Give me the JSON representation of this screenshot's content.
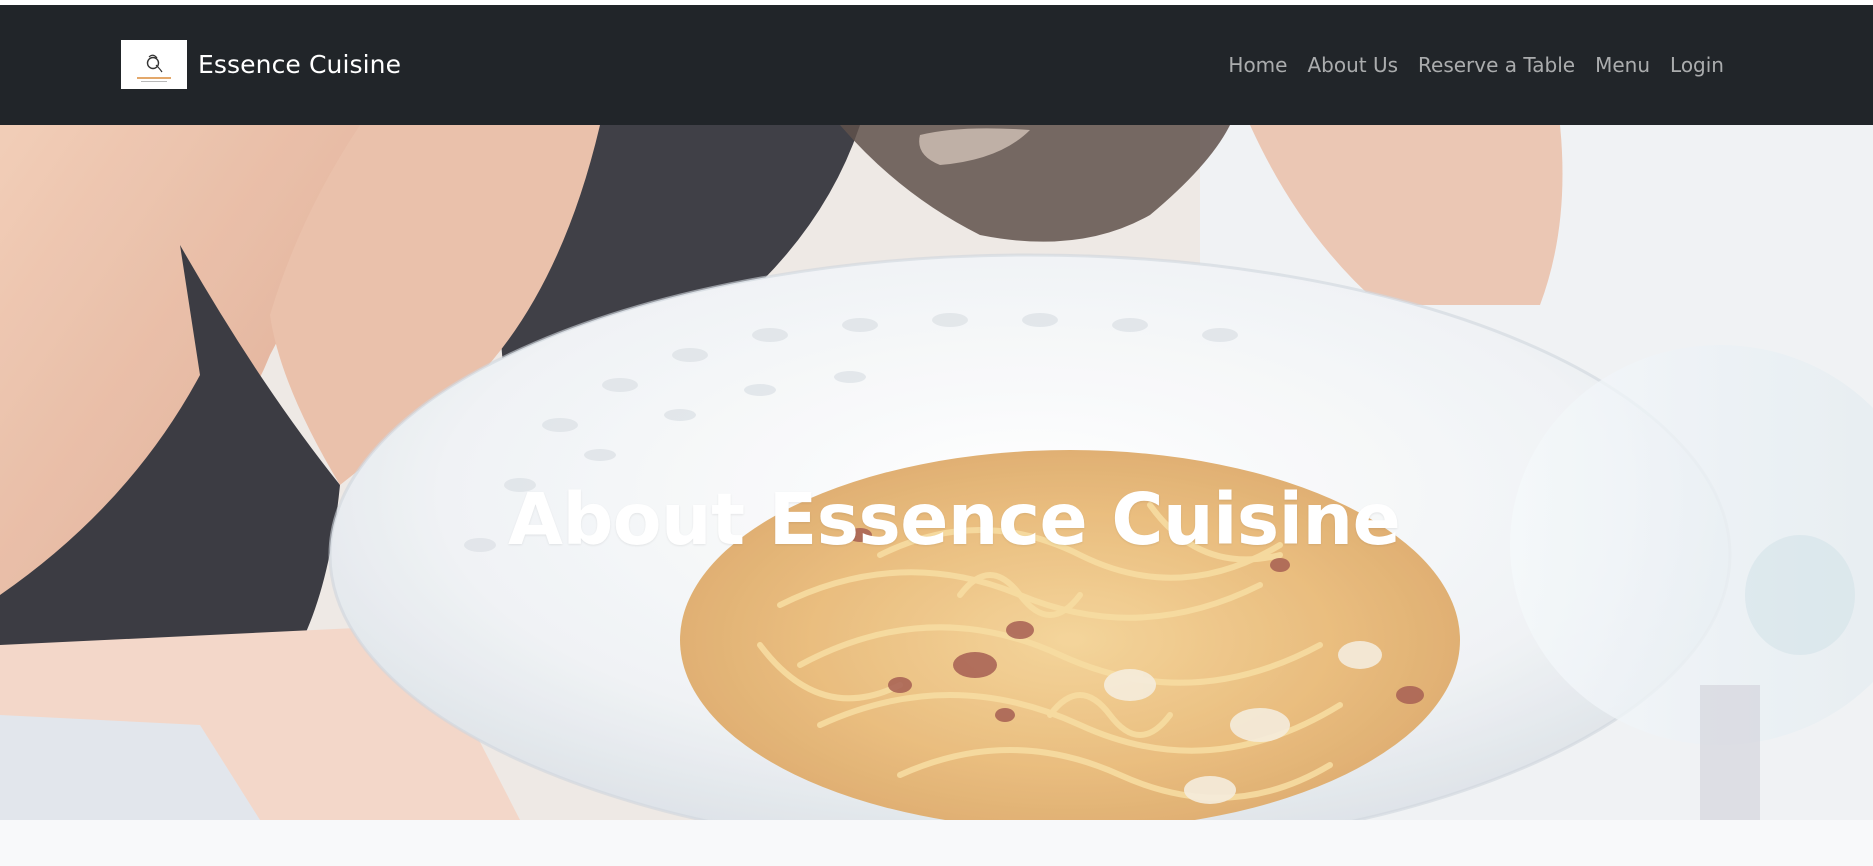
{
  "brand": {
    "name": "Essence Cuisine",
    "logo_icon": "essence-cuisine-logo"
  },
  "nav": {
    "items": [
      {
        "label": "Home"
      },
      {
        "label": "About Us"
      },
      {
        "label": "Reserve a Table"
      },
      {
        "label": "Menu"
      },
      {
        "label": "Login"
      }
    ]
  },
  "hero": {
    "title": "About Essence Cuisine",
    "image": "pasta-carbonara-dinner-photo"
  },
  "colors": {
    "navbar_bg": "#212529",
    "nav_text": "#9a9c9e",
    "hero_title": "#ffffff",
    "page_bg": "#f8f9fa"
  }
}
